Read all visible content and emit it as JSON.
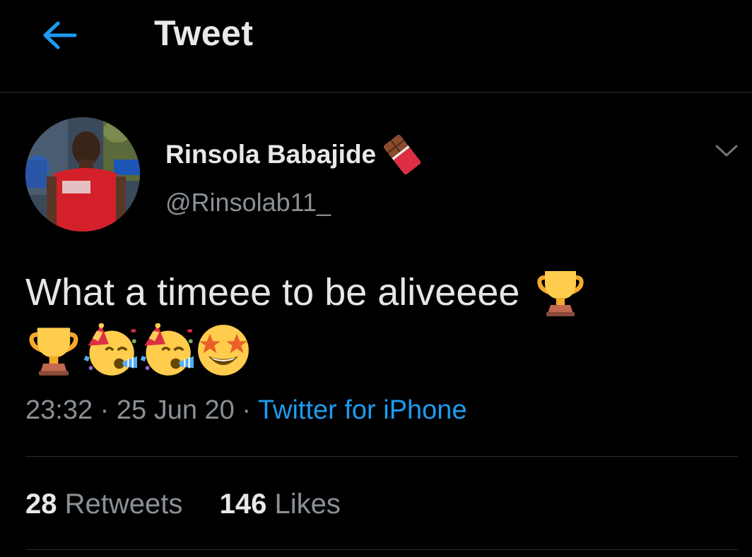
{
  "header": {
    "title": "Tweet",
    "back_icon": "arrow-left-icon",
    "accent_color": "#1d9bf0"
  },
  "author": {
    "name": "Rinsola Babajide",
    "handle": "@Rinsolab11_",
    "name_emoji": "chocolate-bar-emoji"
  },
  "tweet": {
    "text": "What a timeee to be aliveeee",
    "emojis": [
      "trophy-emoji",
      "trophy-emoji",
      "partying-face-emoji",
      "partying-face-emoji",
      "star-struck-emoji"
    ],
    "time": "23:32",
    "separator": "·",
    "date": "25 Jun 20",
    "source": "Twitter for iPhone"
  },
  "stats": {
    "retweets_count": "28",
    "retweets_label": "Retweets",
    "likes_count": "146",
    "likes_label": "Likes"
  }
}
